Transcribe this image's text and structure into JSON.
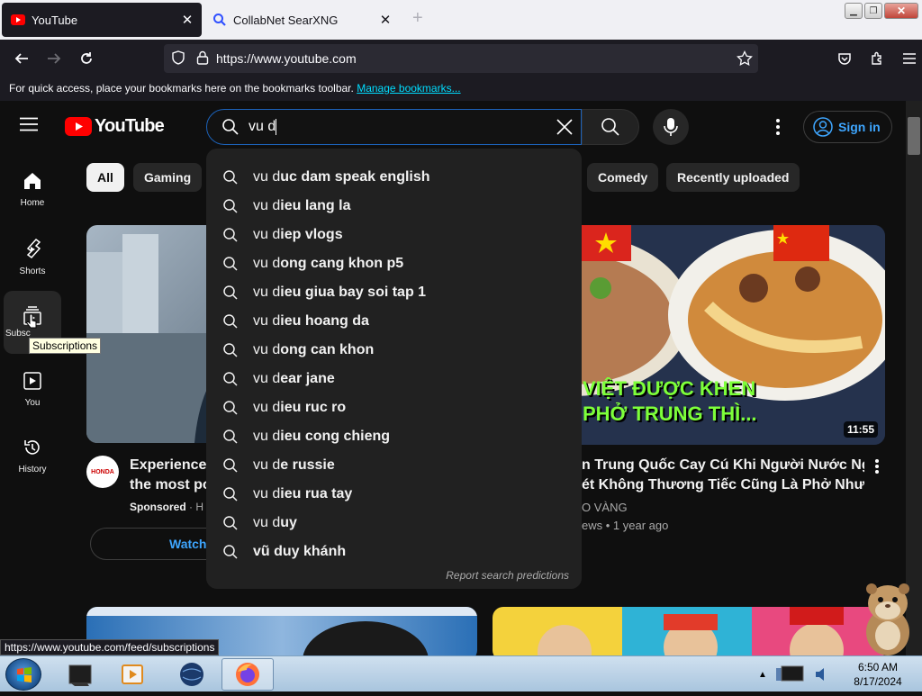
{
  "browser": {
    "tabs": [
      {
        "title": "YouTube",
        "active": true
      },
      {
        "title": "CollabNet SearXNG",
        "active": false
      }
    ],
    "url": "https://www.youtube.com",
    "bookmarks_bar": {
      "text": "For quick access, place your bookmarks here on the bookmarks toolbar.",
      "link": "Manage bookmarks..."
    }
  },
  "youtube": {
    "logo_text": "YouTube",
    "search_query": "vu d",
    "signin_label": "Sign in",
    "guide": [
      {
        "label": "Home"
      },
      {
        "label": "Shorts"
      },
      {
        "label": "Subscriptions"
      },
      {
        "label": "You"
      },
      {
        "label": "History"
      }
    ],
    "guide_subs_partial": "Subsc",
    "tooltip": "Subscriptions",
    "chips": [
      "All",
      "Gaming",
      "Comedy",
      "Recently uploaded"
    ],
    "suggestions": [
      {
        "typed": "vu d",
        "rest": "uc dam speak english"
      },
      {
        "typed": "vu d",
        "rest": "ieu lang la"
      },
      {
        "typed": "vu d",
        "rest": "iep vlogs"
      },
      {
        "typed": "vu d",
        "rest": "ong cang khon p5"
      },
      {
        "typed": "vu d",
        "rest": "ieu giua bay soi tap 1"
      },
      {
        "typed": "vu d",
        "rest": "ieu hoang da"
      },
      {
        "typed": "vu d",
        "rest": "ong can khon"
      },
      {
        "typed": "vu d",
        "rest": "ear jane"
      },
      {
        "typed": "vu d",
        "rest": "ieu ruc ro"
      },
      {
        "typed": "vu d",
        "rest": "ieu cong chieng"
      },
      {
        "typed": "vu d",
        "rest": "e russie"
      },
      {
        "typed": "vu d",
        "rest": "ieu rua tay"
      },
      {
        "typed": "vu d",
        "rest": "uy"
      },
      {
        "typed": "",
        "rest": "vũ duy khánh"
      }
    ],
    "report_link": "Report search predictions",
    "video1": {
      "title_line1": "Experience t",
      "title_line2": "the most po",
      "sponsored": "Sponsored",
      "channel_partial": "H",
      "avatar_text": "HONDA",
      "watch_button": "Watch"
    },
    "video2": {
      "title_line1": "n Trung Quốc Cay Cú Khi Người Nước Ngoài",
      "title_line2": "ét Không Thương Tiếc Cũng Là Phở Nhưn...",
      "channel": "O VÀNG",
      "meta": "ews • 1 year ago",
      "duration": "11:55",
      "overlay_line1": "VIỆT ĐƯỢC KHEN",
      "overlay_line2": "PHỞ TRUNG THÌ..."
    }
  },
  "status_url": "https://www.youtube.com/feed/subscriptions",
  "taskbar": {
    "time": "6:50 AM",
    "date": "8/17/2024"
  },
  "colors": {
    "yt_red": "#ff0000",
    "link_blue": "#3ea6ff",
    "search_focus": "#1c62b9"
  }
}
